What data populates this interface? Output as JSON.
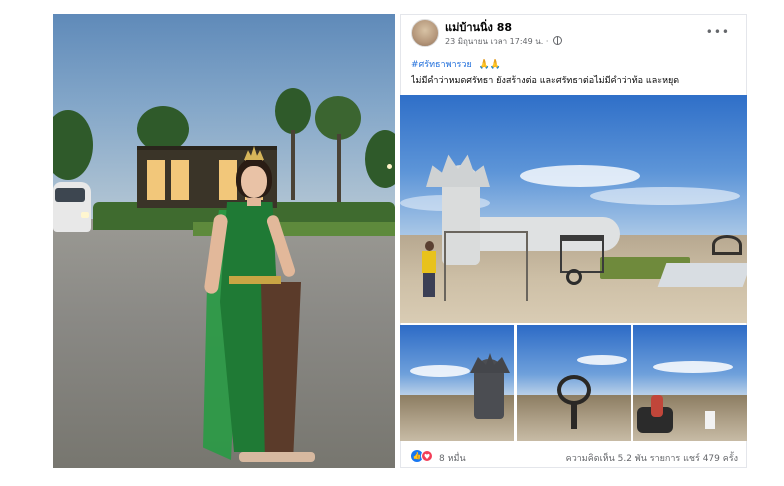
{
  "post": {
    "author": "แม่บ้านนิ่ง 88",
    "timestamp": "23 มิถุนายน เวลา 17:49 น. ·",
    "privacy_icon": "globe-icon",
    "more_icon": "more-horizontal-icon",
    "more_label": "•••",
    "hashtag": "#ศรัทธาพารวย",
    "hashtag_emoji": "🙏🙏",
    "caption": "ไม่มีคำว่าหมดศรัทธา  ยังสร้างต่อ และศรัทธาต่อไม่มีคำว่าท้อ และหยุด",
    "reactions": {
      "like_icon": "like-icon",
      "love_icon": "love-icon",
      "like_glyph": "👍",
      "love_glyph": "♥",
      "count": "8 หมื่น"
    },
    "engagement": "ความคิดเห็น 5.2 พัน รายการ  แชร์ 479 ครั้ง"
  },
  "colors": {
    "link_blue": "#216fdb",
    "like_blue": "#1877f2",
    "love_red": "#f33e58",
    "secondary_text": "#65676b"
  }
}
